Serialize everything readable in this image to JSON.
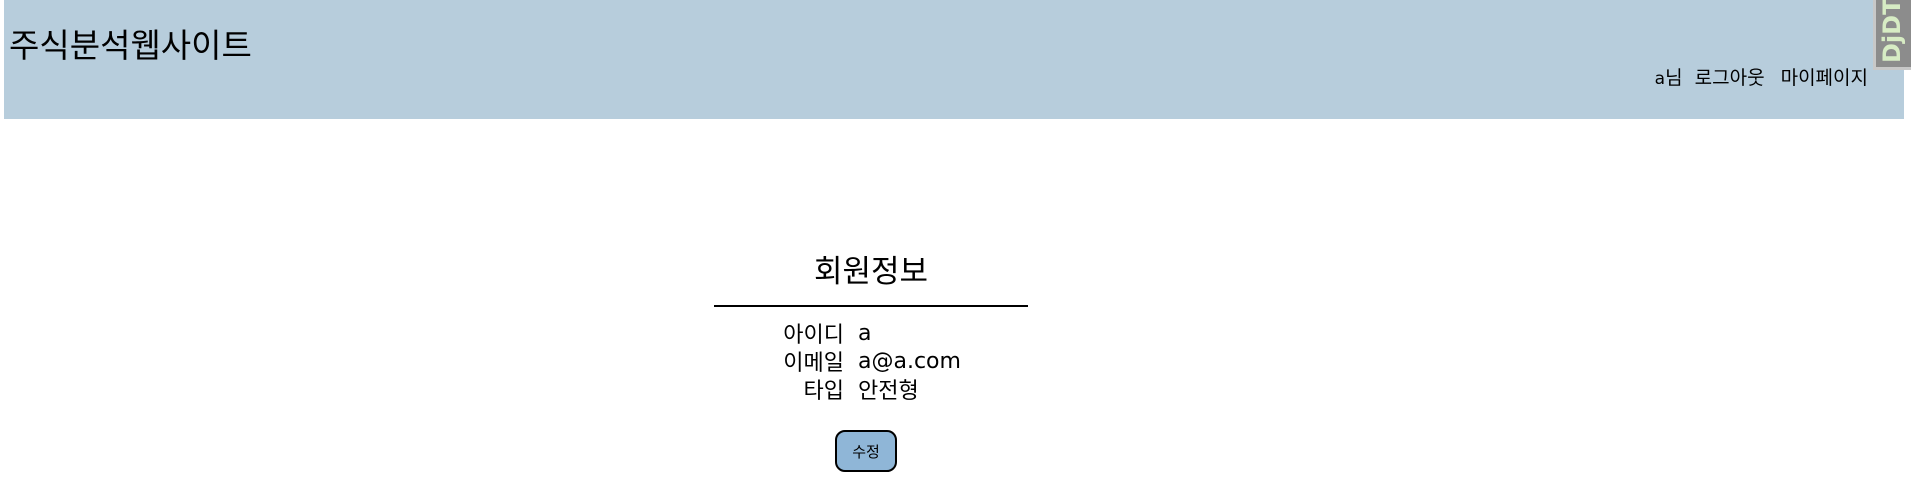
{
  "header": {
    "site_title": "주식분석웹사이트",
    "user_id": "a",
    "user_suffix": "님",
    "logout_label": "로그아웃",
    "mypage_label": "마이페이지",
    "background_color": "#b7cddc"
  },
  "debug_toolbar": {
    "handle_label": "DjDT"
  },
  "member_info": {
    "title": "회원정보",
    "rows": [
      {
        "label": "아이디",
        "value": "a"
      },
      {
        "label": "이메일",
        "value": "a@a.com"
      },
      {
        "label": "타입",
        "value": "안전형"
      }
    ],
    "edit_button_label": "수정",
    "button_color": "#8fb6d7"
  }
}
